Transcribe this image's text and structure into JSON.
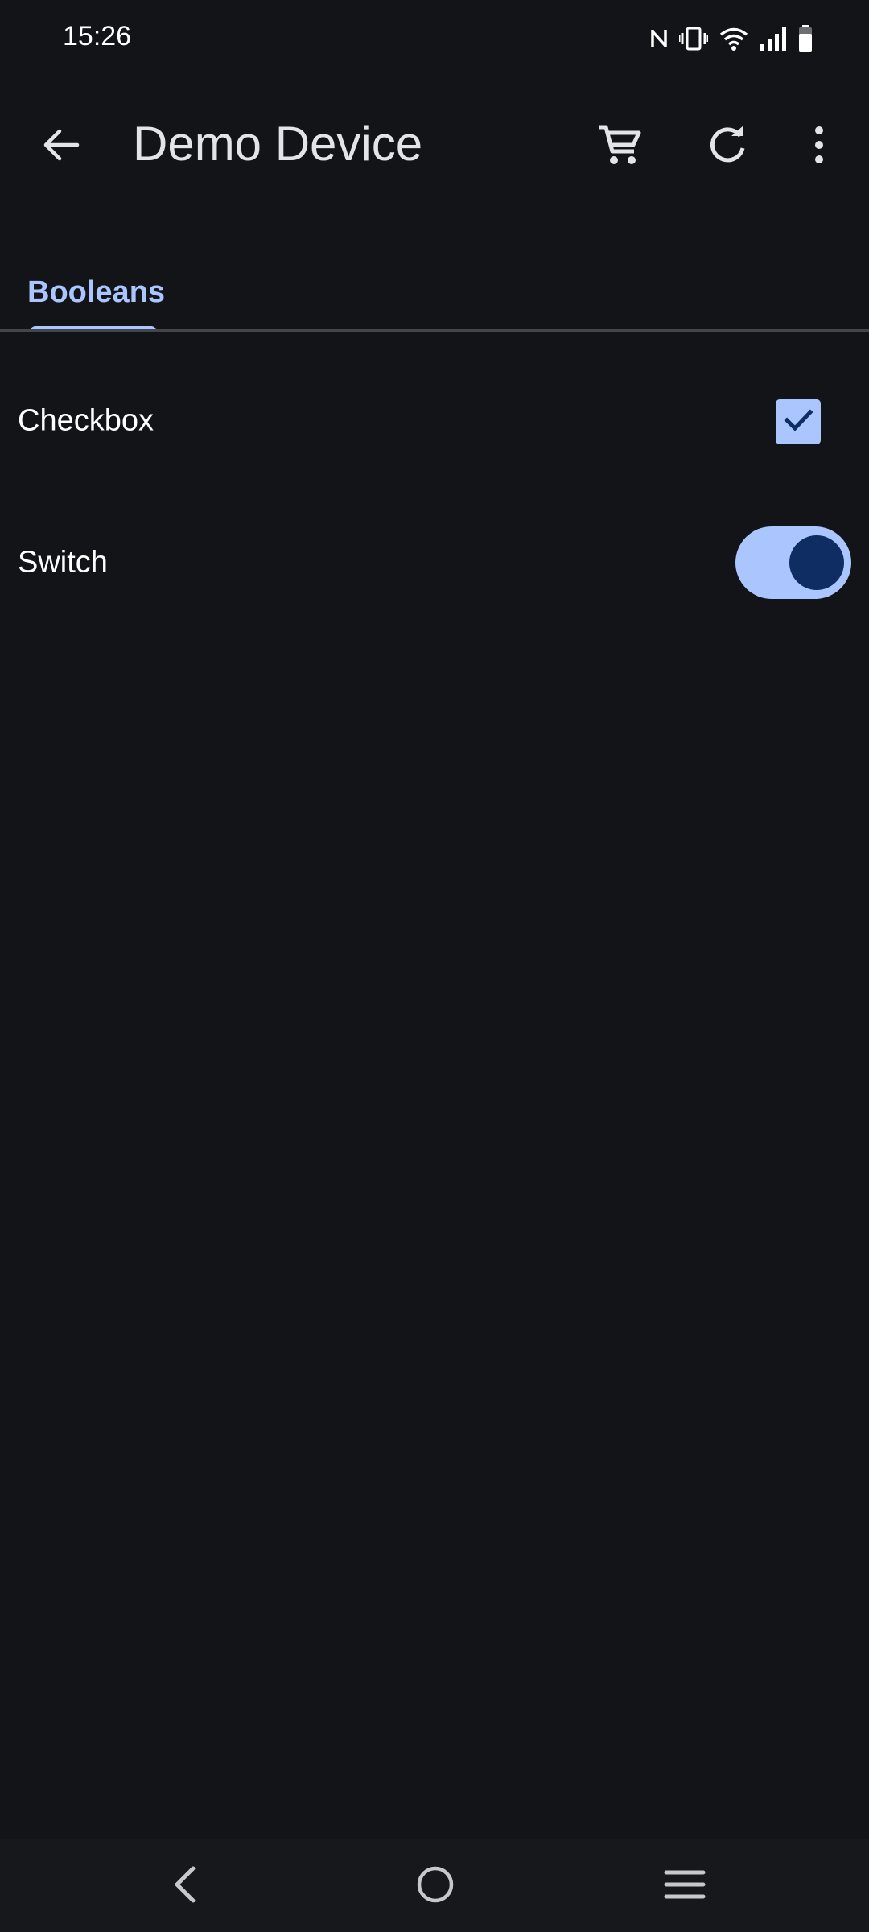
{
  "status_bar": {
    "time": "15:26",
    "icons": [
      "nfc-icon",
      "vibrate-icon",
      "wifi-icon",
      "signal-icon",
      "battery-icon"
    ]
  },
  "app_bar": {
    "title": "Demo Device",
    "back_icon": "arrow-back-icon",
    "actions": [
      "cart-icon",
      "refresh-icon",
      "more-vert-icon"
    ]
  },
  "tabs": [
    {
      "label": "Booleans",
      "selected": true
    }
  ],
  "settings": {
    "checkbox": {
      "label": "Checkbox",
      "checked": true
    },
    "switch": {
      "label": "Switch",
      "on": true
    }
  },
  "nav_bar": {
    "buttons": [
      "nav-back-icon",
      "nav-home-icon",
      "nav-recents-icon"
    ]
  },
  "colors": {
    "background": "#131418",
    "accent": "#abc6ff",
    "accent_dark": "#0f2d63",
    "text": "#e3e3e8"
  }
}
